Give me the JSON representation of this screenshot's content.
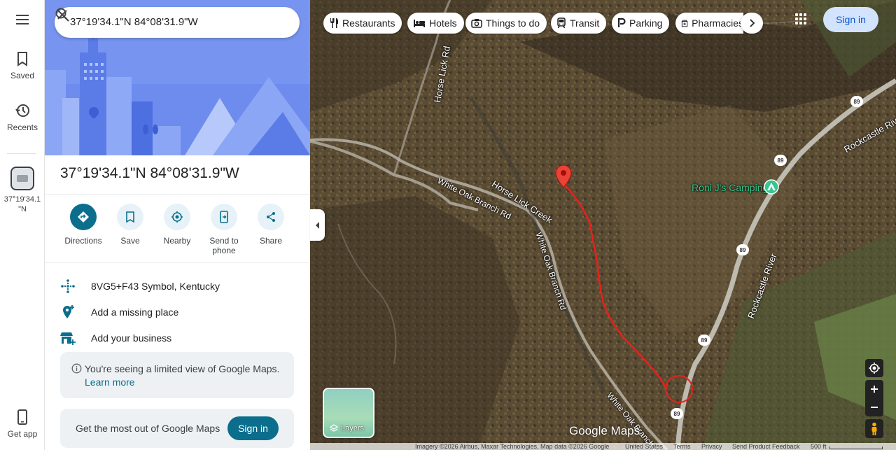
{
  "rail": {
    "saved_label": "Saved",
    "recents_label": "Recents",
    "recent_item_label": "37°19'34.1 \"N",
    "get_app_label": "Get app"
  },
  "search": {
    "value": "37°19'34.1\"N 84°08'31.9\"W"
  },
  "place": {
    "title": "37°19'34.1\"N 84°08'31.9\"W",
    "plus_code": "8VG5+F43 Symbol, Kentucky",
    "add_missing_place": "Add a missing place",
    "add_business": "Add your business"
  },
  "actions": [
    {
      "label": "Directions",
      "icon": "directions-icon"
    },
    {
      "label": "Save",
      "icon": "bookmark-icon"
    },
    {
      "label": "Nearby",
      "icon": "nearby-icon"
    },
    {
      "label": "Send to phone",
      "icon": "send-to-phone-icon"
    },
    {
      "label": "Share",
      "icon": "share-icon"
    }
  ],
  "notice": {
    "text": "You're seeing a limited view of Google Maps.",
    "link": "Learn more"
  },
  "promo": {
    "text": "Get the most out of Google Maps",
    "button": "Sign in"
  },
  "map": {
    "chips": [
      {
        "label": "Restaurants",
        "icon": "fork-knife-icon"
      },
      {
        "label": "Hotels",
        "icon": "bed-icon"
      },
      {
        "label": "Things to do",
        "icon": "camera-icon"
      },
      {
        "label": "Transit",
        "icon": "train-icon"
      },
      {
        "label": "Parking",
        "icon": "parking-icon"
      },
      {
        "label": "Pharmacies",
        "icon": "pharmacy-icon"
      }
    ],
    "sign_in": "Sign in",
    "labels": {
      "horse_lick_rd": "Horse Lick Rd",
      "white_oak_branch_rd": "White Oak Branch Rd",
      "horse_lick_creek": "Horse Lick Creek",
      "rockcastle_river": "Rockcastle River",
      "campground": "Roni J's Camping",
      "route": "89"
    },
    "layers_label": "Layers",
    "logo": "Google Maps",
    "footer": {
      "imagery": "Imagery ©2026 Airbus, Maxar Technologies, Map data ©2026 Google",
      "country": "United States",
      "terms": "Terms",
      "privacy": "Privacy",
      "feedback": "Send Product Feedback",
      "scale": "500 ft"
    },
    "colors": {
      "pin": "#ea4335",
      "track": "#e8211b",
      "campground": "#35c58d"
    }
  }
}
